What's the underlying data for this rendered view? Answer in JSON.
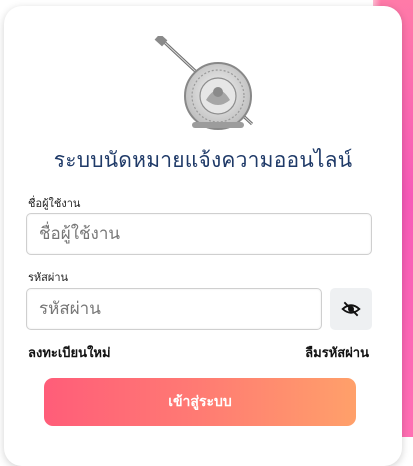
{
  "login": {
    "title": "ระบบนัดหมายแจ้งความออนไลน์",
    "username_label": "ชื่อผู้ใช้งาน",
    "username_placeholder": "ชื่อผู้ใช้งาน",
    "username_value": "",
    "password_label": "รหัสผ่าน",
    "password_placeholder": "รหัสผ่าน",
    "password_value": "",
    "toggle_password_icon": "eye-slash-icon",
    "register_link": "ลงทะเบียนใหม่",
    "forgot_link": "ลืมรหัสผ่าน",
    "submit_label": "เข้าสู่ระบบ"
  },
  "theme": {
    "title_color": "#1f3a68",
    "button_gradient": [
      "#ff5d79",
      "#ffa06a"
    ],
    "side_accent": "#f65ab8"
  }
}
